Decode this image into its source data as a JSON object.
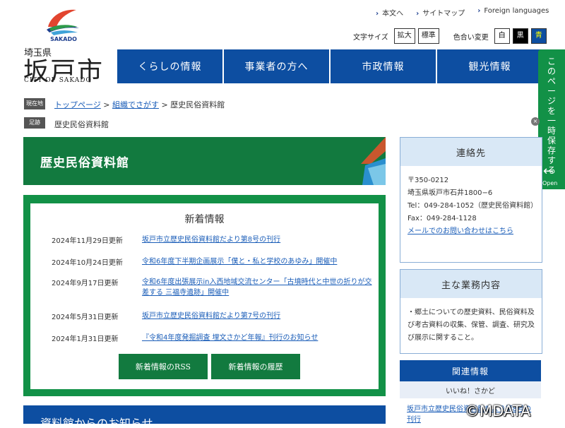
{
  "header": {
    "logo_sub": "SAKADO",
    "pref": "埼玉県",
    "city": "坂戸市",
    "city_en": "CITY OF SAKADO",
    "top_links": [
      "本文へ",
      "サイトマップ",
      "Foreign languages"
    ],
    "text_size_label": "文字サイズ",
    "text_size_buttons": [
      "拡大",
      "標準"
    ],
    "color_label": "色合い変更",
    "color_buttons": [
      "白",
      "黒",
      "青"
    ],
    "nav": [
      "くらしの情報",
      "事業者の方へ",
      "市政情報",
      "観光情報"
    ]
  },
  "save_tab": {
    "text": "このページを一時保存する",
    "open": "Open"
  },
  "breadcrumb": {
    "tag": "現在地",
    "items": [
      "トップページ",
      "組織でさがす",
      "歴史民俗資料館"
    ],
    "foot_tag": "足跡",
    "foot_item": "歴史民俗資料館"
  },
  "main": {
    "title": "歴史民俗資料館",
    "news_heading": "新着情報",
    "news": [
      {
        "date": "2024年11月29日更新",
        "title": "坂戸市立歴史民俗資料館だより第8号の刊行"
      },
      {
        "date": "2024年10月24日更新",
        "title": "令和6年度下半期企画展示「僕と・私と学校のあゆみ」開催中"
      },
      {
        "date": "2024年9月17日更新",
        "title": "令和6年度出張展示in入西地域交流センター「古墳時代と中世の折りが交差する 三福寺遺跡」開催中"
      },
      {
        "date": "2024年5月31日更新",
        "title": "坂戸市立歴史民俗資料館だより第7号の刊行"
      },
      {
        "date": "2024年1月31日更新",
        "title": "『令和4年度発掘調査 埋文さかど年報』刊行のお知らせ"
      }
    ],
    "rss_button": "新着情報のRSS",
    "history_button": "新着情報の履歴",
    "notice_title": "資料館からのお知らせ"
  },
  "sidebar": {
    "contact_title": "連絡先",
    "postal": "〒350-0212",
    "address": "埼玉県坂戸市石井1800−6",
    "tel": "Tel：049-284-1052（歴史民俗資料館）",
    "fax": "Fax：049-284-1128",
    "mail_link": "メールでのお問い合わせはこちら",
    "duties_title": "主な業務内容",
    "duties_text": "・郷土についての歴史資料、民俗資料及び考古資料の収集、保管、調査、研究及び展示に関すること。",
    "related_title": "関連情報",
    "related_sub": "いいね！さかど",
    "related_link": "坂戸市立歴史民俗資料館だより第8号の刊行"
  },
  "watermark": "©MDATA",
  "colors": {
    "nav_blue": "#0d4ea1",
    "green": "#129147",
    "dark_green": "#127a3f"
  }
}
